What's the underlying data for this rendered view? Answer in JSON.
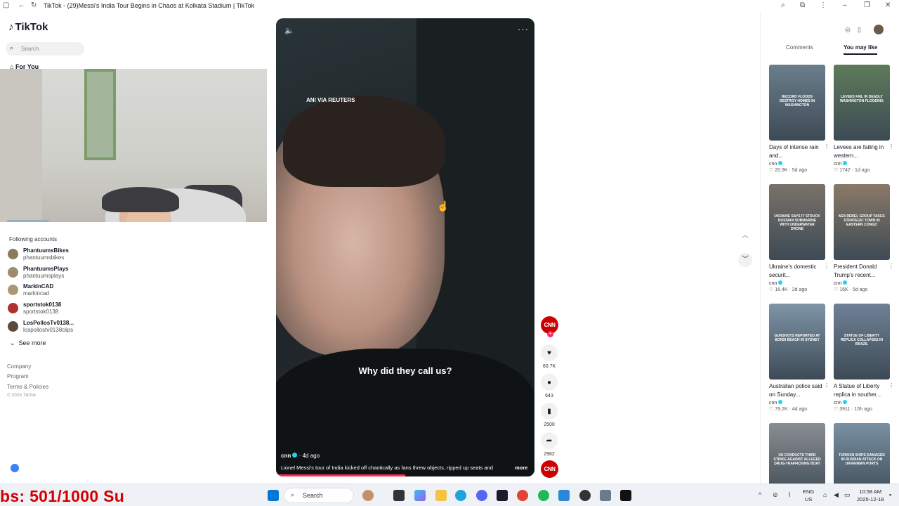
{
  "window": {
    "title": "TikTok - (29)Messi's India Tour Begins in Chaos at Kolkata Stadium | TikTok"
  },
  "nav": {
    "logo": "TikTok",
    "search_placeholder": "Search",
    "for_you": "For You",
    "following_title": "Following accounts",
    "accounts": [
      {
        "name": "PhantuumsBikes",
        "handle": "phantuumsbikes"
      },
      {
        "name": "PhantuumsPlays",
        "handle": "phantuumsplays"
      },
      {
        "name": "MarkInCAD",
        "handle": "markincad"
      },
      {
        "name": "sportstok0138",
        "handle": "sportstok0138"
      },
      {
        "name": "LosPollosTv0138...",
        "handle": "lospollostv0138clips"
      }
    ],
    "see_more": "See more",
    "footer": [
      "Company",
      "Program",
      "Terms & Policies",
      "© 2025 TikTok"
    ]
  },
  "video": {
    "watermark": "ANI VIA REUTERS",
    "caption": "Why did they call us?",
    "author": "cnn",
    "age": " · 4d ago",
    "description": "Lionel Messi's tour of India kicked off chaotically as fans threw objects, ripped up seats and",
    "more": "more",
    "progress": 0.5,
    "channel_logo": "CNN"
  },
  "actions": {
    "likes": "60.7K",
    "comments": "643",
    "saves": "2500",
    "shares": "2962"
  },
  "panel": {
    "tabs": [
      "Comments",
      "You may like"
    ],
    "active_tab": "You may like",
    "cards": [
      {
        "overlay": "Record floods destroy homes in Washington",
        "title": "Days of intense rain and...",
        "author": "cnn",
        "likes": "20.9K",
        "age": "5d ago",
        "color": "#6b7e8c"
      },
      {
        "overlay": "Levees fail in deadly Washington flooding",
        "title": "Levees are failing in western...",
        "author": "cnn",
        "likes": "1742",
        "age": "1d ago",
        "color": "#5e7a5a"
      },
      {
        "overlay": "Ukraine says it struck Russian submarine with underwater drone",
        "title": "Ukraine's domestic securit...",
        "author": "cnn",
        "likes": "16.4K",
        "age": "2d ago",
        "color": "#7a726a"
      },
      {
        "overlay": "M23 rebel group takes strategic town in Eastern Congo",
        "title": "President Donald Trump's recent...",
        "author": "cnn",
        "likes": "16K",
        "age": "5d ago",
        "color": "#8a7a68"
      },
      {
        "overlay": "Gunshots reported at Bondi Beach in Sydney",
        "title": "Australian police said on Sunday...",
        "author": "cnn",
        "likes": "79.2K",
        "age": "4d ago",
        "color": "#7f95a8"
      },
      {
        "overlay": "Statue of Liberty replica collapses in Brazil",
        "title": "A Statue of Liberty replica in souther...",
        "author": "cnn",
        "likes": "3911",
        "age": "15h ago",
        "color": "#6f8196"
      },
      {
        "overlay": "US conducts third strike against alleged drug-trafficking boat",
        "title": "",
        "author": "",
        "likes": "",
        "age": "",
        "color": "#8a8e92"
      },
      {
        "overlay": "Turkish ships damaged in Russian attack on Ukrainian ports",
        "title": "",
        "author": "",
        "likes": "",
        "age": "",
        "color": "#7a90a4"
      }
    ]
  },
  "taskbar": {
    "counter": "bs: 501/1000  Su",
    "search": "Search",
    "lang_top": "ENG",
    "lang_bottom": "US",
    "time": "10:58 AM",
    "date": "2025-12-18"
  }
}
